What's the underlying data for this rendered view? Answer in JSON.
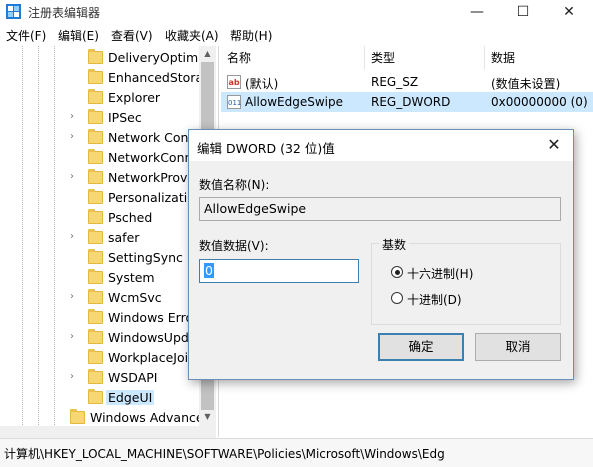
{
  "window": {
    "title": "注册表编辑器",
    "controls": {
      "minimize": "—",
      "maximize": "☐",
      "close": "✕"
    }
  },
  "menu": {
    "items": [
      "文件(F)",
      "编辑(E)",
      "查看(V)",
      "收藏夹(A)",
      "帮助(H)"
    ]
  },
  "tree": {
    "items": [
      {
        "label": "DeliveryOptimiz",
        "chevron": ""
      },
      {
        "label": "EnhancedStorag",
        "chevron": ""
      },
      {
        "label": "Explorer",
        "chevron": ""
      },
      {
        "label": "IPSec",
        "chevron": "›"
      },
      {
        "label": "Network Conr",
        "chevron": "›"
      },
      {
        "label": "NetworkConn",
        "chevron": ""
      },
      {
        "label": "NetworkProvi",
        "chevron": "›"
      },
      {
        "label": "Personalizatic",
        "chevron": ""
      },
      {
        "label": "Psched",
        "chevron": ""
      },
      {
        "label": "safer",
        "chevron": "›"
      },
      {
        "label": "SettingSync",
        "chevron": ""
      },
      {
        "label": "System",
        "chevron": ""
      },
      {
        "label": "WcmSvc",
        "chevron": "›"
      },
      {
        "label": "Windows Erro",
        "chevron": ""
      },
      {
        "label": "WindowsUpd",
        "chevron": "›"
      },
      {
        "label": "WorkplaceJoi",
        "chevron": ""
      },
      {
        "label": "WSDAPI",
        "chevron": "›"
      },
      {
        "label": "EdgeUI",
        "chevron": ""
      }
    ],
    "partial_item": "Windows Advance"
  },
  "values": {
    "headers": {
      "name": "名称",
      "type": "类型",
      "data": "数据"
    },
    "rows": [
      {
        "icon": "ab",
        "name": "(默认)",
        "type": "REG_SZ",
        "data": "(数值未设置)"
      },
      {
        "icon": "011",
        "name": "AllowEdgeSwipe",
        "type": "REG_DWORD",
        "data": "0x00000000 (0)"
      }
    ]
  },
  "status": {
    "path": "计算机\\HKEY_LOCAL_MACHINE\\SOFTWARE\\Policies\\Microsoft\\Windows\\Edg"
  },
  "dialog": {
    "title": "编辑 DWORD (32 位)值",
    "close": "✕",
    "name_label": "数值名称(N):",
    "name_value": "AllowEdgeSwipe",
    "data_label": "数值数据(V):",
    "data_value": "0",
    "base_label": "基数",
    "radio_hex": "十六进制(H)",
    "radio_dec": "十进制(D)",
    "selected_base": "hex",
    "ok": "确定",
    "cancel": "取消"
  }
}
